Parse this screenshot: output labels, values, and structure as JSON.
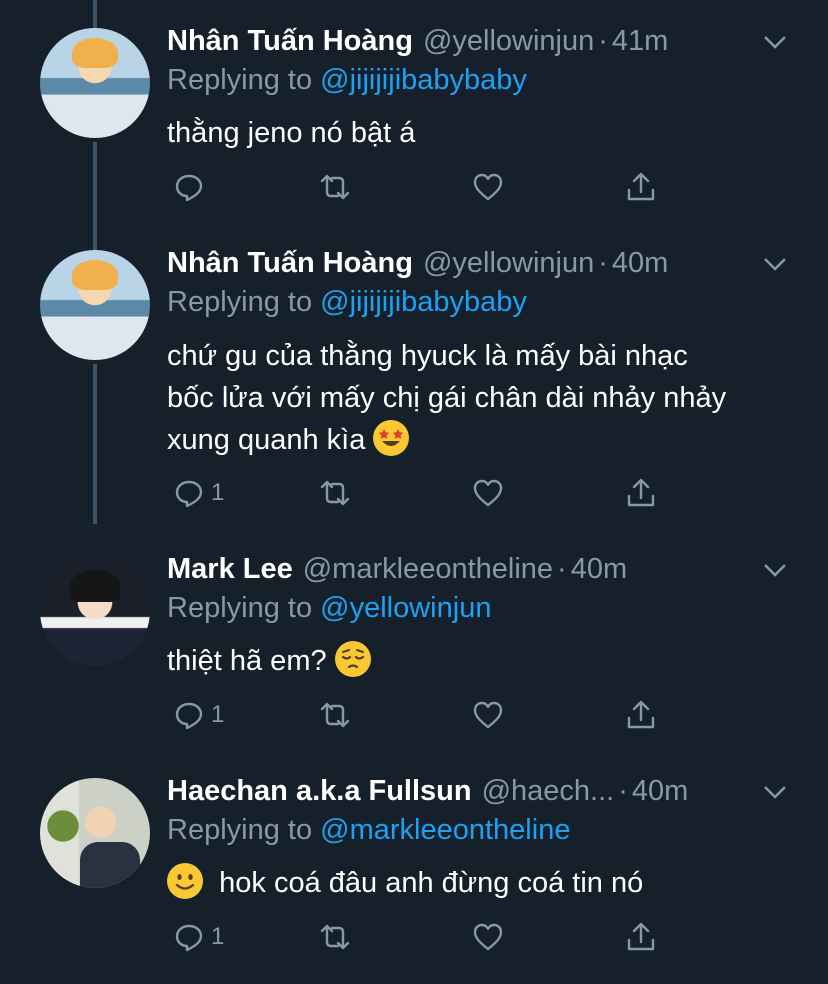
{
  "tweets": [
    {
      "name": "Nhân Tuấn Hoàng",
      "handle": "@yellowinjun",
      "time": "41m",
      "reply_prefix": "Replying to",
      "reply_to": "@jijijijibabybaby",
      "lines": [
        "thằng jeno nó bật á"
      ],
      "reply_count": "",
      "emoji": ""
    },
    {
      "name": "Nhân Tuấn Hoàng",
      "handle": "@yellowinjun",
      "time": "40m",
      "reply_prefix": "Replying to",
      "reply_to": "@jijijijibabybaby",
      "lines": [
        "chứ gu của thằng hyuck là mấy bài nhạc",
        "bốc lửa với mấy chị gái chân dài nhảy nhảy",
        "xung quanh kìa"
      ],
      "reply_count": "1",
      "emoji": "star-struck-emoji"
    },
    {
      "name": "Mark Lee",
      "handle": "@markleeontheline",
      "time": "40m",
      "reply_prefix": "Replying to",
      "reply_to": "@yellowinjun",
      "lines": [
        "thiệt hã em?"
      ],
      "reply_count": "1",
      "emoji": "pensive-face-emoji"
    },
    {
      "name": "Haechan a.k.a Fullsun",
      "handle": "@haech...",
      "time": "40m",
      "reply_prefix": "Replying to",
      "reply_to": "@markleeontheline",
      "lines": [
        "hok coá đâu anh đừng coá tin nó"
      ],
      "reply_count": "1",
      "emoji": "slightly-smiling-face-emoji"
    }
  ],
  "dot": "·",
  "colors": {
    "background": "#15202b",
    "text": "#ffffff",
    "secondary": "#8899a6",
    "link": "#1da1f2"
  }
}
